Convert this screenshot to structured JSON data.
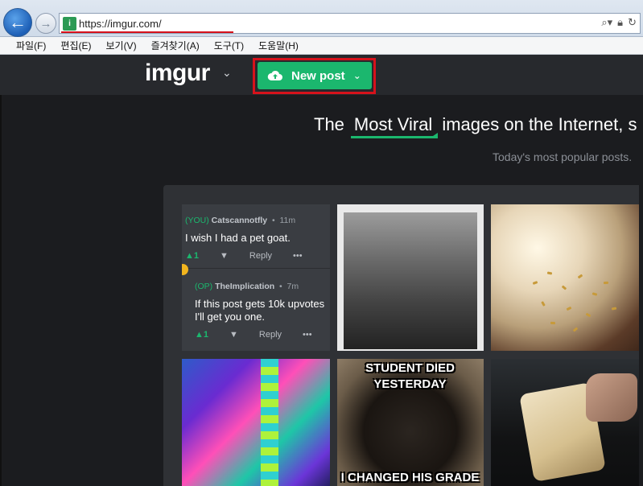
{
  "browser": {
    "url": "https://imgur.com/",
    "menu": [
      "파일(F)",
      "편집(E)",
      "보기(V)",
      "즐겨찾기(A)",
      "도구(T)",
      "도움말(H)"
    ]
  },
  "site": {
    "logo": "imgur",
    "new_post_label": "New post",
    "hero": {
      "before": "The",
      "highlight": "Most Viral",
      "after": "images on the Internet, s"
    },
    "subhero": "Today's most popular posts."
  },
  "comments": [
    {
      "tag": "(YOU)",
      "name": "Catscannotfly",
      "time": "11m",
      "text": "I wish I had a pet goat.",
      "votes": "1",
      "reply": "Reply",
      "more": "•••"
    },
    {
      "tag": "(OP)",
      "name": "TheImplication",
      "time": "7m",
      "text": "If this post gets 10k upvotes I'll get you one.",
      "votes": "1",
      "reply": "Reply",
      "more": "•••"
    }
  ],
  "memes": {
    "bear_top": "STUDENT DIED\nYESTERDAY",
    "bear_bottom": "I CHANGED HIS GRADE"
  },
  "colors": {
    "brand_green": "#1bb76e",
    "highlight_red": "#d6121b",
    "header_bg": "#27292d",
    "page_bg": "#1b1c1f"
  },
  "icons": {
    "back": "back-arrow-icon",
    "forward": "forward-arrow-icon",
    "favicon": "imgur-favicon-icon",
    "search": "search-icon",
    "lock": "lock-icon",
    "refresh": "refresh-icon",
    "upload": "cloud-upload-icon"
  }
}
